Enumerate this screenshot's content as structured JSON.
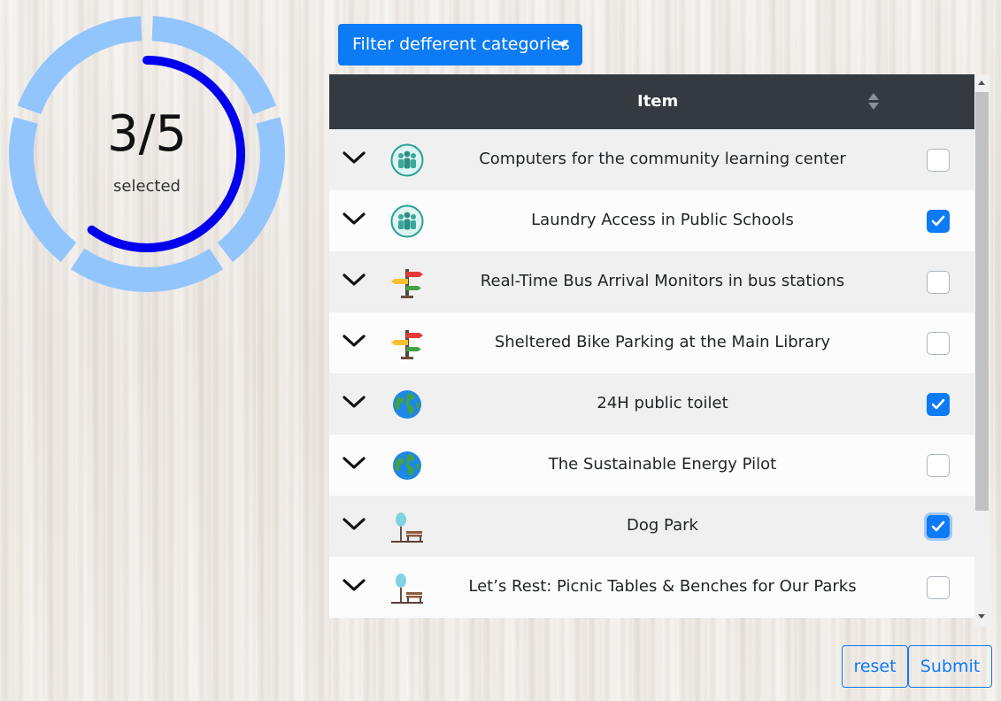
{
  "progress": {
    "count_text": "3/5",
    "label": "selected",
    "selected": 3,
    "total": 5,
    "segment_color": "#93c5fd",
    "arc_color": "#0000ee"
  },
  "filter": {
    "label": "Filter defferent categories"
  },
  "table": {
    "header": "Item",
    "rows": [
      {
        "title": "Computers for the community learning center",
        "icon": "community-people-icon",
        "checked": false
      },
      {
        "title": "Laundry Access in Public Schools",
        "icon": "community-people-icon",
        "checked": true
      },
      {
        "title": "Real-Time Bus Arrival Monitors in bus stations",
        "icon": "signpost-icon",
        "checked": false
      },
      {
        "title": "Sheltered Bike Parking at the Main Library",
        "icon": "signpost-icon",
        "checked": false
      },
      {
        "title": "24H public toilet",
        "icon": "globe-icon",
        "checked": true
      },
      {
        "title": "The Sustainable Energy Pilot",
        "icon": "globe-icon",
        "checked": false
      },
      {
        "title": "Dog Park",
        "icon": "park-bench-icon",
        "checked": true,
        "focused": true
      },
      {
        "title": "Let’s Rest: Picnic Tables & Benches for Our Parks",
        "icon": "park-bench-icon",
        "checked": false
      }
    ]
  },
  "buttons": {
    "reset": "reset",
    "submit": "Submit"
  },
  "colors": {
    "primary": "#0d7bf5",
    "header_bg": "#343a40"
  }
}
